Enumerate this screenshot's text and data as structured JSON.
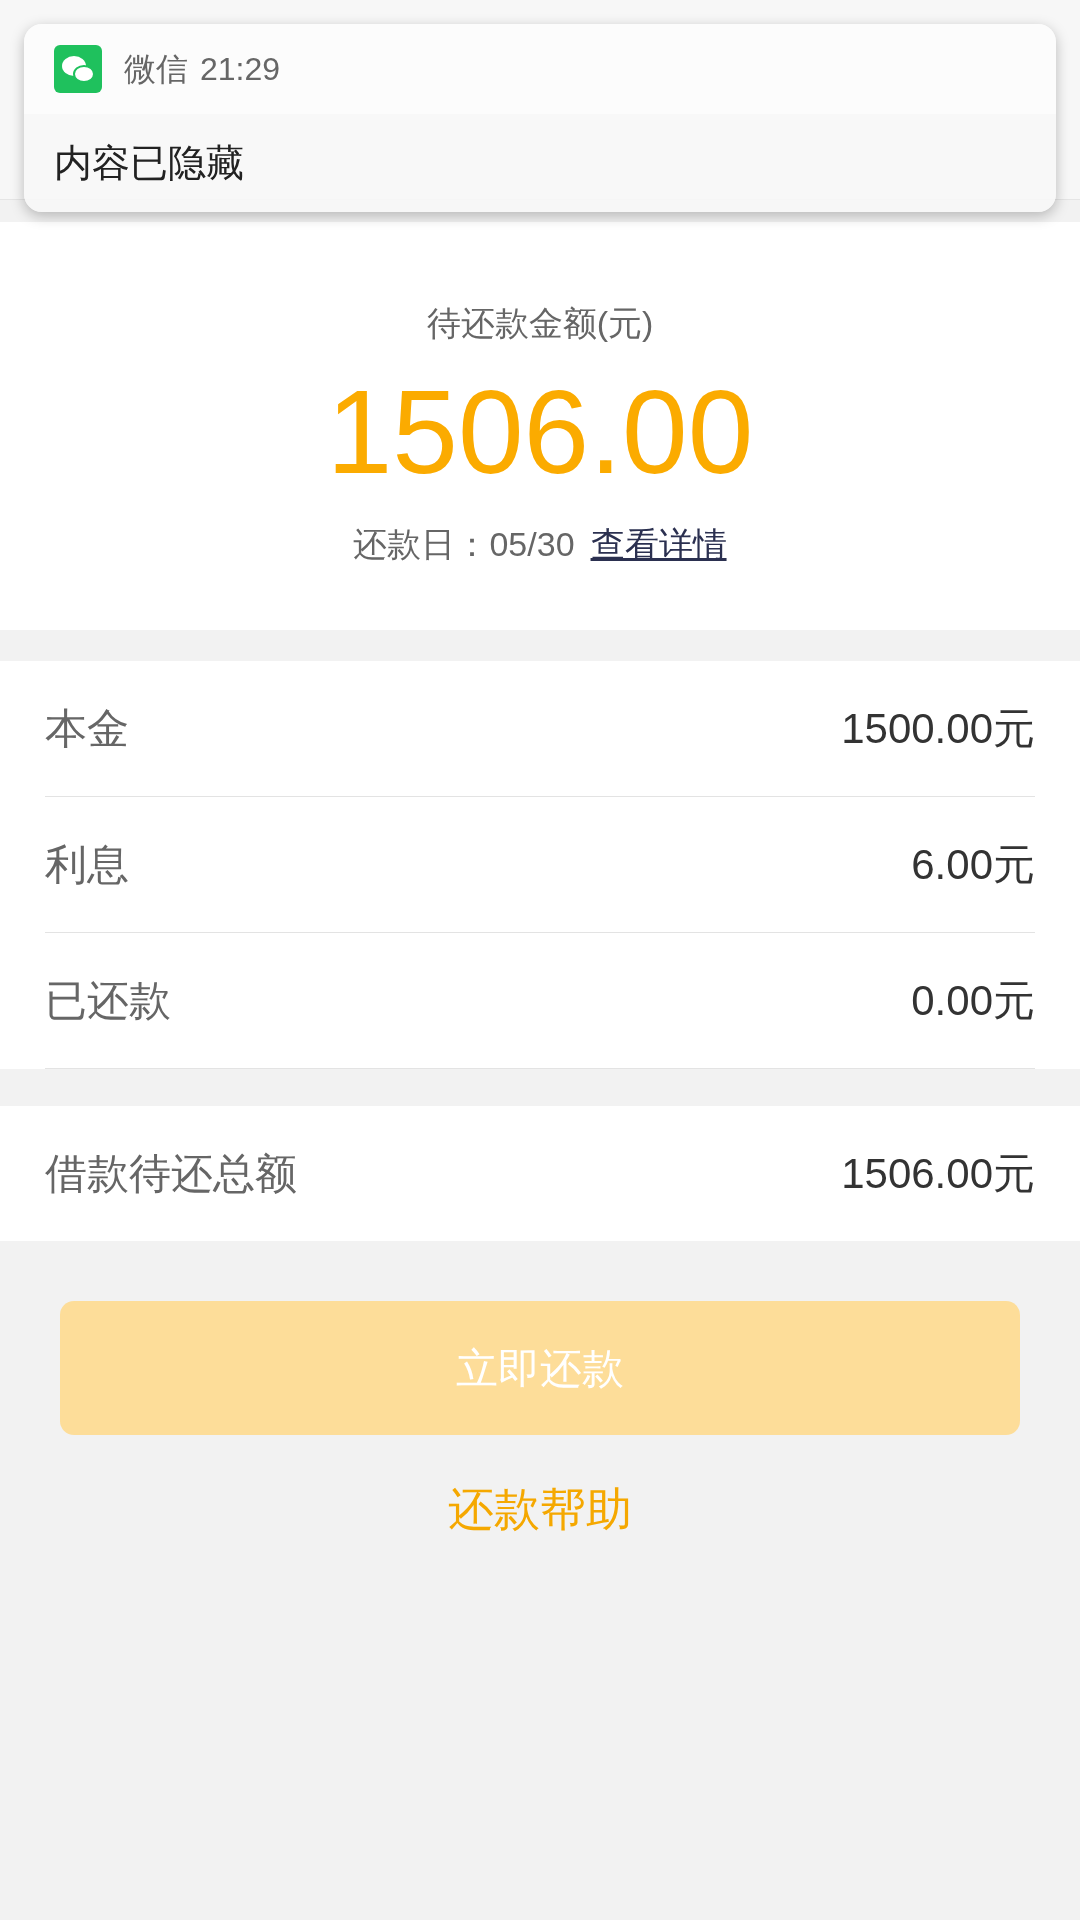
{
  "notification": {
    "app": "微信",
    "time": "21:29",
    "body": "内容已隐藏"
  },
  "summary": {
    "label": "待还款金额(元)",
    "amount": "1506.00",
    "due_label": "还款日：05/30",
    "details_link": "查看详情"
  },
  "items": [
    {
      "label": "本金",
      "value": "1500.00元"
    },
    {
      "label": "利息",
      "value": "6.00元"
    },
    {
      "label": "已还款",
      "value": "0.00元"
    }
  ],
  "total": {
    "label": "借款待还总额",
    "value": "1506.00元"
  },
  "pay_button": {
    "label": "立即还款",
    "disabled": true
  },
  "help_link": "还款帮助"
}
